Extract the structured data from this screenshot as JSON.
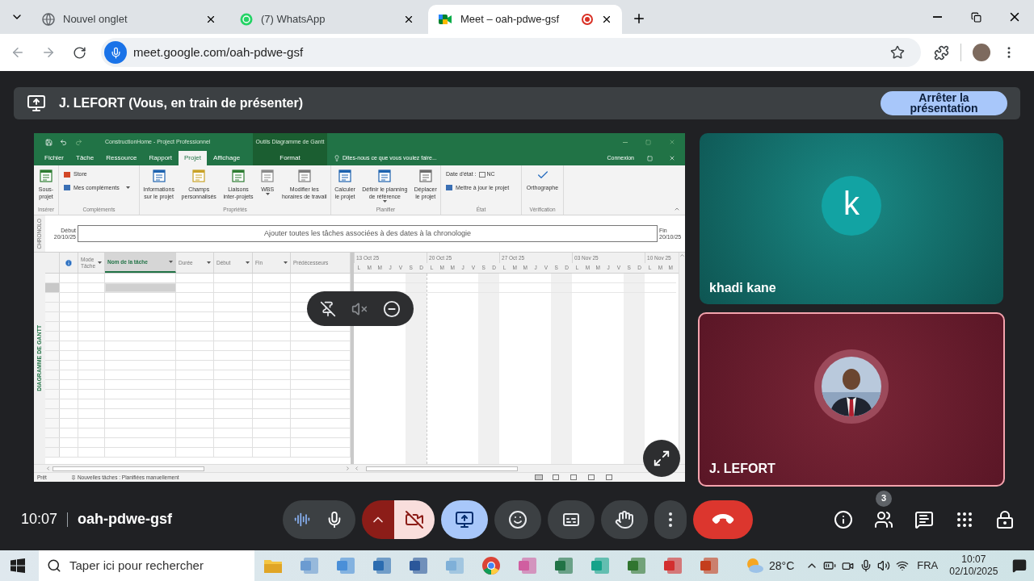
{
  "browser": {
    "tabs": [
      {
        "title": "Nouvel onglet",
        "kind": "newtab",
        "selected": false,
        "recording": false
      },
      {
        "title": "(7) WhatsApp",
        "kind": "whatsapp",
        "selected": false,
        "recording": false
      },
      {
        "title": "Meet – oah-pdwe-gsf",
        "kind": "meet",
        "selected": true,
        "recording": true
      }
    ],
    "url": "meet.google.com/oah-pdwe-gsf"
  },
  "banner": {
    "text": "J. LEFORT (Vous, en train de présenter)",
    "stop_button": "Arrêter la présentation"
  },
  "project": {
    "title": "ConstructionHome - Project Professionnel",
    "context_label": "Outils Diagramme de Gantt",
    "tabs": [
      {
        "label": "Fichier",
        "selected": false
      },
      {
        "label": "Tâche",
        "selected": false
      },
      {
        "label": "Ressource",
        "selected": false
      },
      {
        "label": "Rapport",
        "selected": false
      },
      {
        "label": "Projet",
        "selected": true
      },
      {
        "label": "Affichage",
        "selected": false
      }
    ],
    "context_tab": {
      "label": "Format",
      "selected": false
    },
    "tell_me": "Dites-nous ce que vous voulez faire...",
    "sign_in": "Connexion",
    "groups": [
      {
        "label": "Insérer",
        "buttons": [
          {
            "label": "Sous-\nprojet",
            "kind": "large",
            "dropdown": false
          }
        ]
      },
      {
        "label": "Compléments",
        "buttons": [
          {
            "label": "Store",
            "kind": "small",
            "dropdown": false
          },
          {
            "label": "Mes compléments",
            "kind": "small",
            "dropdown": true
          }
        ]
      },
      {
        "label": "Propriétés",
        "buttons": [
          {
            "label": "Informations\nsur le projet",
            "kind": "large",
            "dropdown": false
          },
          {
            "label": "Champs\npersonnalisés",
            "kind": "large",
            "dropdown": false
          },
          {
            "label": "Liaisons\ninter-projets",
            "kind": "large",
            "dropdown": false
          },
          {
            "label": "WBS",
            "kind": "large",
            "dropdown": true
          },
          {
            "label": "Modifier les\nhoraires de travail",
            "kind": "large",
            "dropdown": false
          }
        ]
      },
      {
        "label": "Planifier",
        "buttons": [
          {
            "label": "Calculer\nle projet",
            "kind": "large",
            "dropdown": false
          },
          {
            "label": "Définir le planning\nde référence",
            "kind": "large",
            "dropdown": true
          },
          {
            "label": "Déplacer\nle projet",
            "kind": "large",
            "dropdown": false
          }
        ]
      },
      {
        "label": "État",
        "buttons": [
          {
            "label": "Date d'état :",
            "kind": "field",
            "value": "NC"
          },
          {
            "label": "Mettre à jour le projet",
            "kind": "small",
            "dropdown": false
          }
        ]
      },
      {
        "label": "Vérification",
        "buttons": [
          {
            "label": "Orthographe",
            "kind": "large",
            "dropdown": false
          }
        ]
      }
    ],
    "timeline": {
      "side_label": "CHRONOLO",
      "start_label": "Début",
      "start_date": "20/10/25",
      "placeholder": "Ajouter toutes les tâches associées à des dates à la chronologie",
      "end_label": "Fin",
      "end_date": "20/10/25"
    },
    "view_label": "DIAGRAMME DE GANTT",
    "columns": [
      {
        "kind": "info",
        "selected": false
      },
      {
        "kind": "text",
        "label": "Mode\nTâche",
        "selected": false,
        "dropdown": true
      },
      {
        "kind": "text",
        "label": "Nom de la tâche",
        "selected": true,
        "dropdown": true
      },
      {
        "kind": "text",
        "label": "Durée",
        "selected": false,
        "dropdown": true
      },
      {
        "kind": "text",
        "label": "Début",
        "selected": false,
        "dropdown": true
      },
      {
        "kind": "text",
        "label": "Fin",
        "selected": false,
        "dropdown": true
      },
      {
        "kind": "text",
        "label": "Prédécesseurs",
        "selected": false,
        "dropdown": false
      }
    ],
    "rows": [
      {
        "selected": false
      },
      {
        "selected": true
      },
      {
        "selected": false
      },
      {
        "selected": false
      },
      {
        "selected": false
      },
      {
        "selected": false
      },
      {
        "selected": false
      },
      {
        "selected": false
      },
      {
        "selected": false
      },
      {
        "selected": false
      },
      {
        "selected": false
      },
      {
        "selected": false
      },
      {
        "selected": false
      },
      {
        "selected": false
      },
      {
        "selected": false
      },
      {
        "selected": false
      },
      {
        "selected": false
      },
      {
        "selected": false
      },
      {
        "selected": false
      }
    ],
    "weeks": [
      {
        "label": "13 Oct 25",
        "days": [
          "L",
          "M",
          "M",
          "J",
          "V",
          "S",
          "D"
        ]
      },
      {
        "label": "20 Oct 25",
        "days": [
          "L",
          "M",
          "M",
          "J",
          "V",
          "S",
          "D"
        ]
      },
      {
        "label": "27 Oct 25",
        "days": [
          "L",
          "M",
          "M",
          "J",
          "V",
          "S",
          "D"
        ]
      },
      {
        "label": "03 Nov 25",
        "days": [
          "L",
          "M",
          "M",
          "J",
          "V",
          "S",
          "D"
        ]
      },
      {
        "label": "10 Nov 25",
        "days": [
          "L",
          "M",
          "M"
        ]
      }
    ],
    "status": {
      "ready": "Prêt",
      "new_tasks": "Nouvelles tâches : Planifiées manuellement"
    }
  },
  "participants": [
    {
      "name": "khadi kane",
      "kind": "letter",
      "initial": "k",
      "highlighted": false
    },
    {
      "name": "J. LEFORT",
      "highlighted": true
    }
  ],
  "meeting": {
    "time": "10:07",
    "code": "oah-pdwe-gsf"
  },
  "controls": [
    {
      "kind": "mic",
      "on": true
    },
    {
      "kind": "camera",
      "on": false
    },
    {
      "kind": "present",
      "on": true
    },
    {
      "kind": "reactions",
      "on": false
    },
    {
      "kind": "captions",
      "on": false
    },
    {
      "kind": "hand",
      "on": false
    },
    {
      "kind": "more",
      "on": false
    },
    {
      "kind": "leave",
      "on": false
    }
  ],
  "side_buttons": [
    {
      "kind": "info"
    },
    {
      "kind": "people",
      "badge": "3"
    },
    {
      "kind": "chat"
    },
    {
      "kind": "activities"
    },
    {
      "kind": "host"
    }
  ],
  "taskbar": {
    "search_placeholder": "Taper ici pour rechercher",
    "weather": "28°C",
    "language": "FRA",
    "time": "10:07",
    "date": "02/10/2025"
  }
}
